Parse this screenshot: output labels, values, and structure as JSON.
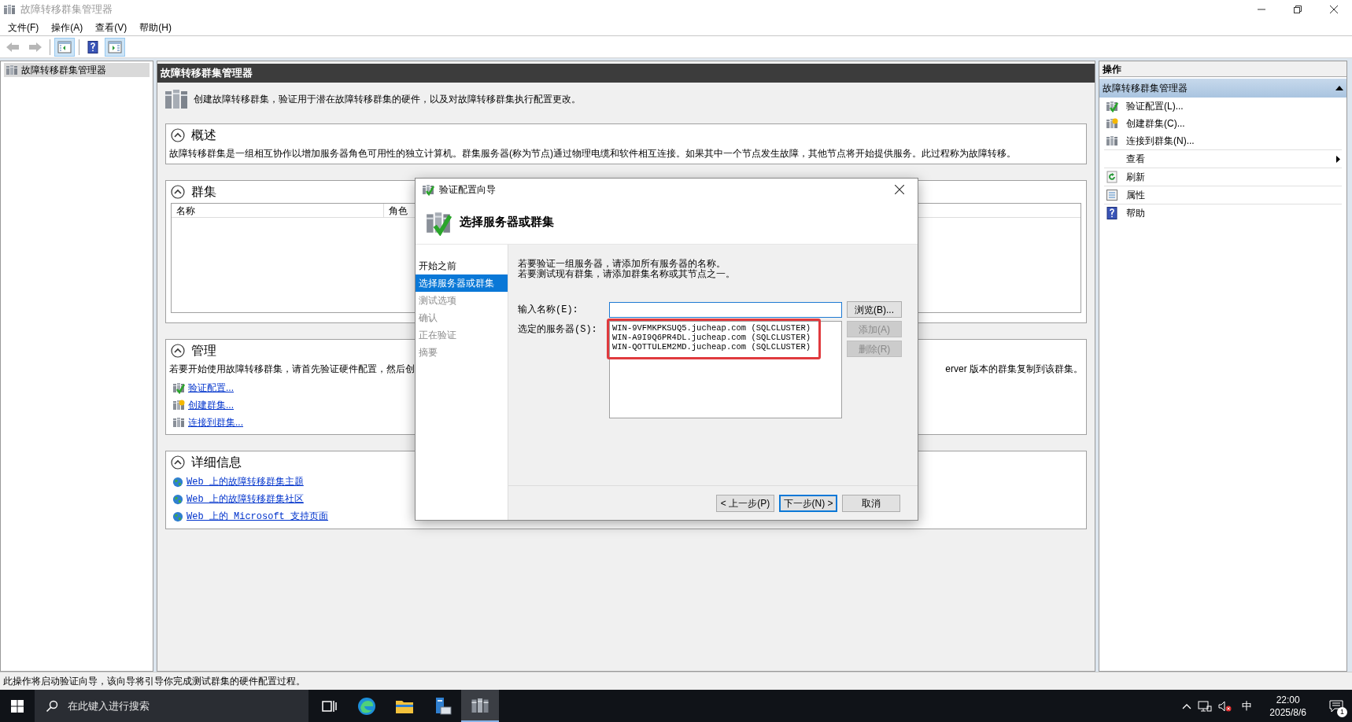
{
  "window": {
    "title": "故障转移群集管理器"
  },
  "menu": [
    "文件(F)",
    "操作(A)",
    "查看(V)",
    "帮助(H)"
  ],
  "toolbar": [
    {
      "kind": "back",
      "disabled": true,
      "pressed": false
    },
    {
      "kind": "forward",
      "disabled": true,
      "pressed": false
    },
    {
      "kind": "separator"
    },
    {
      "kind": "tree-toggle",
      "disabled": false,
      "pressed": true
    },
    {
      "kind": "separator"
    },
    {
      "kind": "help",
      "disabled": false,
      "pressed": false
    },
    {
      "kind": "pane-toggle",
      "disabled": false,
      "pressed": true
    }
  ],
  "tree": [
    {
      "label": "故障转移群集管理器",
      "selected": true
    }
  ],
  "center": {
    "header": "故障转移群集管理器",
    "description": "创建故障转移群集，验证用于潜在故障转移群集的硬件，以及对故障转移群集执行配置更改。",
    "sections": [
      {
        "kind": "text",
        "title": "概述",
        "expanded": true,
        "text": "故障转移群集是一组相互协作以增加服务器角色可用性的独立计算机。群集服务器(称为节点)通过物理电缆和软件相互连接。如果其中一个节点发生故障，其他节点将开始提供服务。此过程称为故障转移。"
      },
      {
        "kind": "table",
        "title": "群集",
        "expanded": true,
        "columns": [
          "名称",
          "角色"
        ]
      },
      {
        "kind": "links",
        "title": "管理",
        "expanded": true,
        "text_parts": [
          "若要开始使用故障转移群集，请首先验证硬件配置，然后创",
          "erver 版本的群集复制到该群集。"
        ],
        "links": [
          {
            "label": "验证配置...",
            "kind": "validate"
          },
          {
            "label": "创建群集...",
            "kind": "create"
          },
          {
            "label": "连接到群集...",
            "kind": "connect"
          }
        ]
      },
      {
        "kind": "links",
        "title": "详细信息",
        "expanded": true,
        "links": [
          {
            "label": "Web 上的故障转移群集主题",
            "kind": "web"
          },
          {
            "label": "Web 上的故障转移群集社区",
            "kind": "web"
          },
          {
            "label": "Web 上的 Microsoft 支持页面",
            "kind": "web"
          }
        ]
      }
    ]
  },
  "actions": {
    "title": "操作",
    "group": {
      "label": "故障转移群集管理器",
      "expanded": true
    },
    "items": [
      {
        "label": "验证配置(L)...",
        "kind": "validate"
      },
      {
        "label": "创建群集(C)...",
        "kind": "create"
      },
      {
        "label": "连接到群集(N)...",
        "kind": "connect"
      },
      {
        "label": "查看",
        "kind": "view"
      },
      {
        "label": "刷新",
        "kind": "refresh"
      },
      {
        "label": "属性",
        "kind": "properties"
      },
      {
        "label": "帮助",
        "kind": "help"
      }
    ]
  },
  "dialog": {
    "title": "验证配置向导",
    "heading": "选择服务器或群集",
    "steps": [
      {
        "label": "开始之前",
        "selected": false,
        "disabled": false
      },
      {
        "label": "选择服务器或群集",
        "selected": true,
        "disabled": false
      },
      {
        "label": "测试选项",
        "selected": false,
        "disabled": true
      },
      {
        "label": "确认",
        "selected": false,
        "disabled": true
      },
      {
        "label": "正在验证",
        "selected": false,
        "disabled": true
      },
      {
        "label": "摘要",
        "selected": false,
        "disabled": true
      }
    ],
    "instructions": [
      "若要验证一组服务器，请添加所有服务器的名称。",
      "若要测试现有群集，请添加群集名称或其节点之一。"
    ],
    "name_label": "输入名称(E):",
    "browse": {
      "label": "浏览(B)...",
      "disabled": false
    },
    "servers_label": "选定的服务器(S):",
    "servers": {
      "highlighted": true,
      "items": [
        "WIN-9VFMKPKSUQ5.jucheap.com (SQLCLUSTER)",
        "WIN-A9I9Q6PR4DL.jucheap.com (SQLCLUSTER)",
        "WIN-QOTTULEM2MD.jucheap.com (SQLCLUSTER)"
      ]
    },
    "side_buttons": [
      {
        "label": "添加(A)",
        "disabled": true
      },
      {
        "label": "删除(R)",
        "disabled": true
      }
    ],
    "buttons": [
      {
        "label": "< 上一步(P)",
        "default": false
      },
      {
        "label": "下一步(N) >",
        "default": true
      },
      {
        "label": "取消",
        "default": false
      }
    ]
  },
  "status_bar": "此操作将启动验证向导，该向导将引导你完成测试群集的硬件配置过程。",
  "taskbar": {
    "search_placeholder": "在此键入进行搜索",
    "apps": [
      {
        "kind": "taskview",
        "active": false
      },
      {
        "kind": "edge",
        "active": false
      },
      {
        "kind": "explorer",
        "active": false
      },
      {
        "kind": "servermanager",
        "active": false
      },
      {
        "kind": "cluster",
        "active": true
      }
    ],
    "ime": "中",
    "time": "22:00",
    "date": "2025/8/6",
    "notifications": "1"
  }
}
